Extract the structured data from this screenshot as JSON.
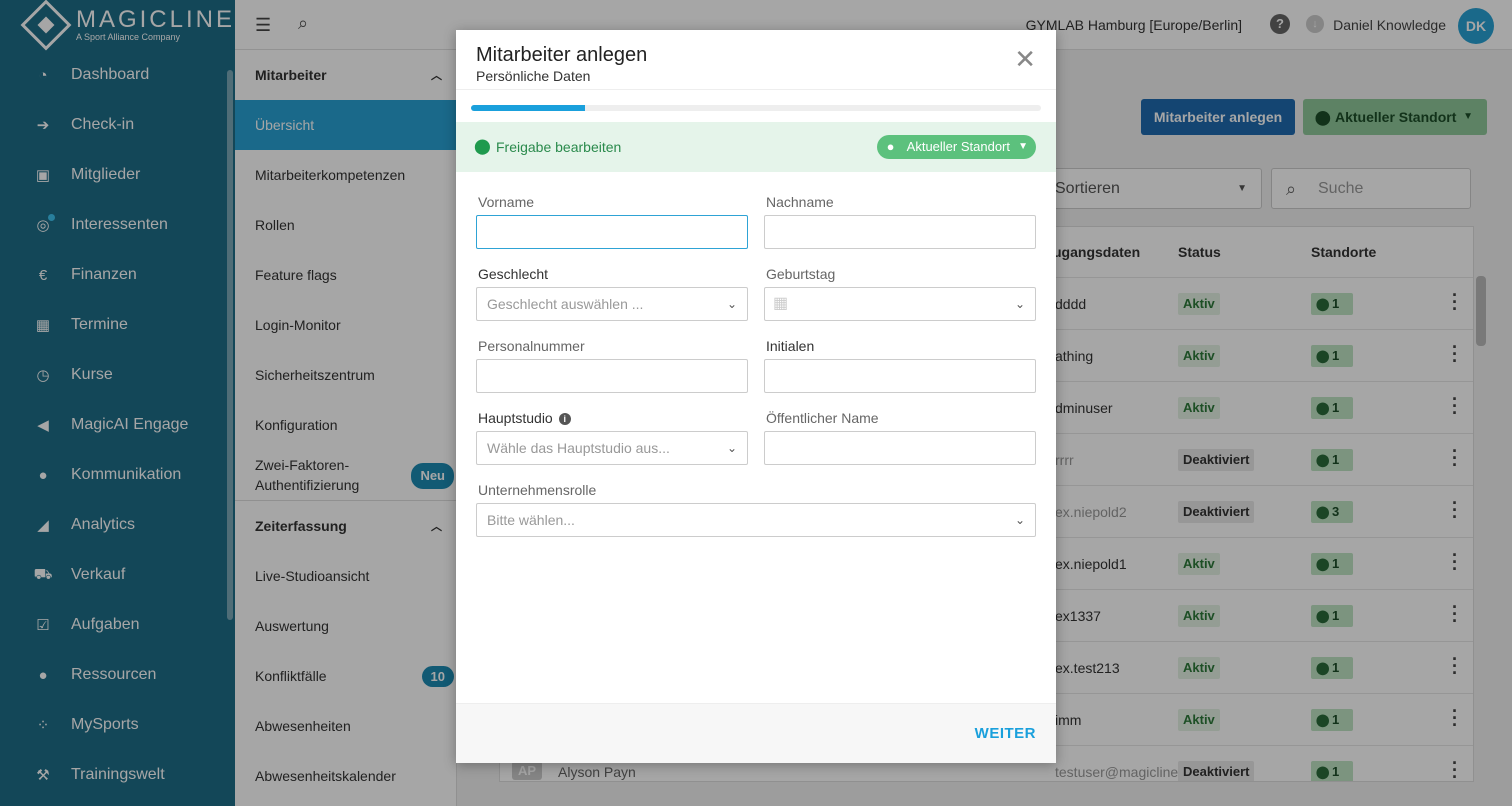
{
  "brand": {
    "name": "MAGICLINE",
    "tagline": "A Sport Alliance Company"
  },
  "nav": [
    {
      "label": "Dashboard",
      "icon": "dashboard-icon",
      "glyph": "◔"
    },
    {
      "label": "Check-in",
      "icon": "checkin-icon",
      "glyph": "➔"
    },
    {
      "label": "Mitglieder",
      "icon": "members-icon",
      "glyph": "▣"
    },
    {
      "label": "Interessenten",
      "icon": "prospects-icon",
      "glyph": "◎"
    },
    {
      "label": "Finanzen",
      "icon": "finance-icon",
      "glyph": "€"
    },
    {
      "label": "Termine",
      "icon": "calendar-icon",
      "glyph": "▦"
    },
    {
      "label": "Kurse",
      "icon": "timer-icon",
      "glyph": "◷"
    },
    {
      "label": "MagicAI Engage",
      "icon": "megaphone-icon",
      "glyph": "◀"
    },
    {
      "label": "Kommunikation",
      "icon": "chat-icon",
      "glyph": "●"
    },
    {
      "label": "Analytics",
      "icon": "chart-icon",
      "glyph": "◢"
    },
    {
      "label": "Verkauf",
      "icon": "cart-icon",
      "glyph": "⛟"
    },
    {
      "label": "Aufgaben",
      "icon": "tasks-icon",
      "glyph": "☑"
    },
    {
      "label": "Ressourcen",
      "icon": "resources-icon",
      "glyph": "●"
    },
    {
      "label": "MySports",
      "icon": "mysports-icon",
      "glyph": "⁘"
    },
    {
      "label": "Trainingswelt",
      "icon": "training-icon",
      "glyph": "⚒"
    }
  ],
  "subnav": {
    "section1": "Mitarbeiter",
    "items1": [
      "Übersicht",
      "Mitarbeiterkompetenzen",
      "Rollen",
      "Feature flags",
      "Login-Monitor",
      "Sicherheitszentrum",
      "Konfiguration"
    ],
    "twofa_line1": "Zwei-Faktoren-",
    "twofa_line2": "Authentifizierung",
    "twofa_badge": "Neu",
    "section2": "Zeiterfassung",
    "items2": [
      "Live-Studioansicht",
      "Auswertung",
      "Konfliktfälle",
      "Abwesenheiten",
      "Abwesenheitskalender"
    ],
    "conflict_badge": "10"
  },
  "topbar": {
    "studio": "GYMLAB Hamburg [Europe/Berlin]",
    "user": "Daniel Knowledge",
    "initials": "DK"
  },
  "main": {
    "create_btn": "Mitarbeiter anlegen",
    "location_btn": "Aktueller Standort",
    "sort": "Sortieren",
    "search_placeholder": "Suche",
    "headers": {
      "access": "ugangsdaten",
      "status": "Status",
      "locations": "Standorte"
    },
    "rows": [
      {
        "access": "dddd",
        "status": "Aktiv",
        "locs": "1"
      },
      {
        "access": "athing",
        "status": "Aktiv",
        "locs": "1"
      },
      {
        "access": "dminuser",
        "status": "Aktiv",
        "locs": "1"
      },
      {
        "access": "rrrr",
        "status": "Deaktiviert",
        "locs": "1"
      },
      {
        "access": "ex.niepold2",
        "status": "Deaktiviert",
        "locs": "3"
      },
      {
        "access": "ex.niepold1",
        "status": "Aktiv",
        "locs": "1"
      },
      {
        "access": "ex1337",
        "status": "Aktiv",
        "locs": "1"
      },
      {
        "access": "ex.test213",
        "status": "Aktiv",
        "locs": "1"
      },
      {
        "access": "imm",
        "status": "Aktiv",
        "locs": "1"
      },
      {
        "access": "testuser@magicline",
        "status": "Deaktiviert",
        "locs": "1"
      }
    ],
    "peek_name": "Alyson Payn",
    "peek_initials": "AP"
  },
  "modal": {
    "title": "Mitarbeiter anlegen",
    "subtitle": "Persönliche Daten",
    "progress": 0.2,
    "share_label": "Freigabe bearbeiten",
    "share_chip": "Aktueller Standort",
    "fields": {
      "firstname": {
        "label": "Vorname",
        "value": ""
      },
      "lastname": {
        "label": "Nachname",
        "value": ""
      },
      "gender": {
        "label": "Geschlecht",
        "placeholder": "Geschlecht auswählen ..."
      },
      "birthday": {
        "label": "Geburtstag"
      },
      "staffno": {
        "label": "Personalnummer"
      },
      "initials": {
        "label": "Initialen"
      },
      "mainstudio": {
        "label": "Hauptstudio",
        "placeholder": "Wähle das Hauptstudio aus..."
      },
      "publicname": {
        "label": "Öffentlicher Name"
      },
      "role": {
        "label": "Unternehmensrolle",
        "placeholder": "Bitte wählen..."
      }
    },
    "next": "WEITER"
  }
}
